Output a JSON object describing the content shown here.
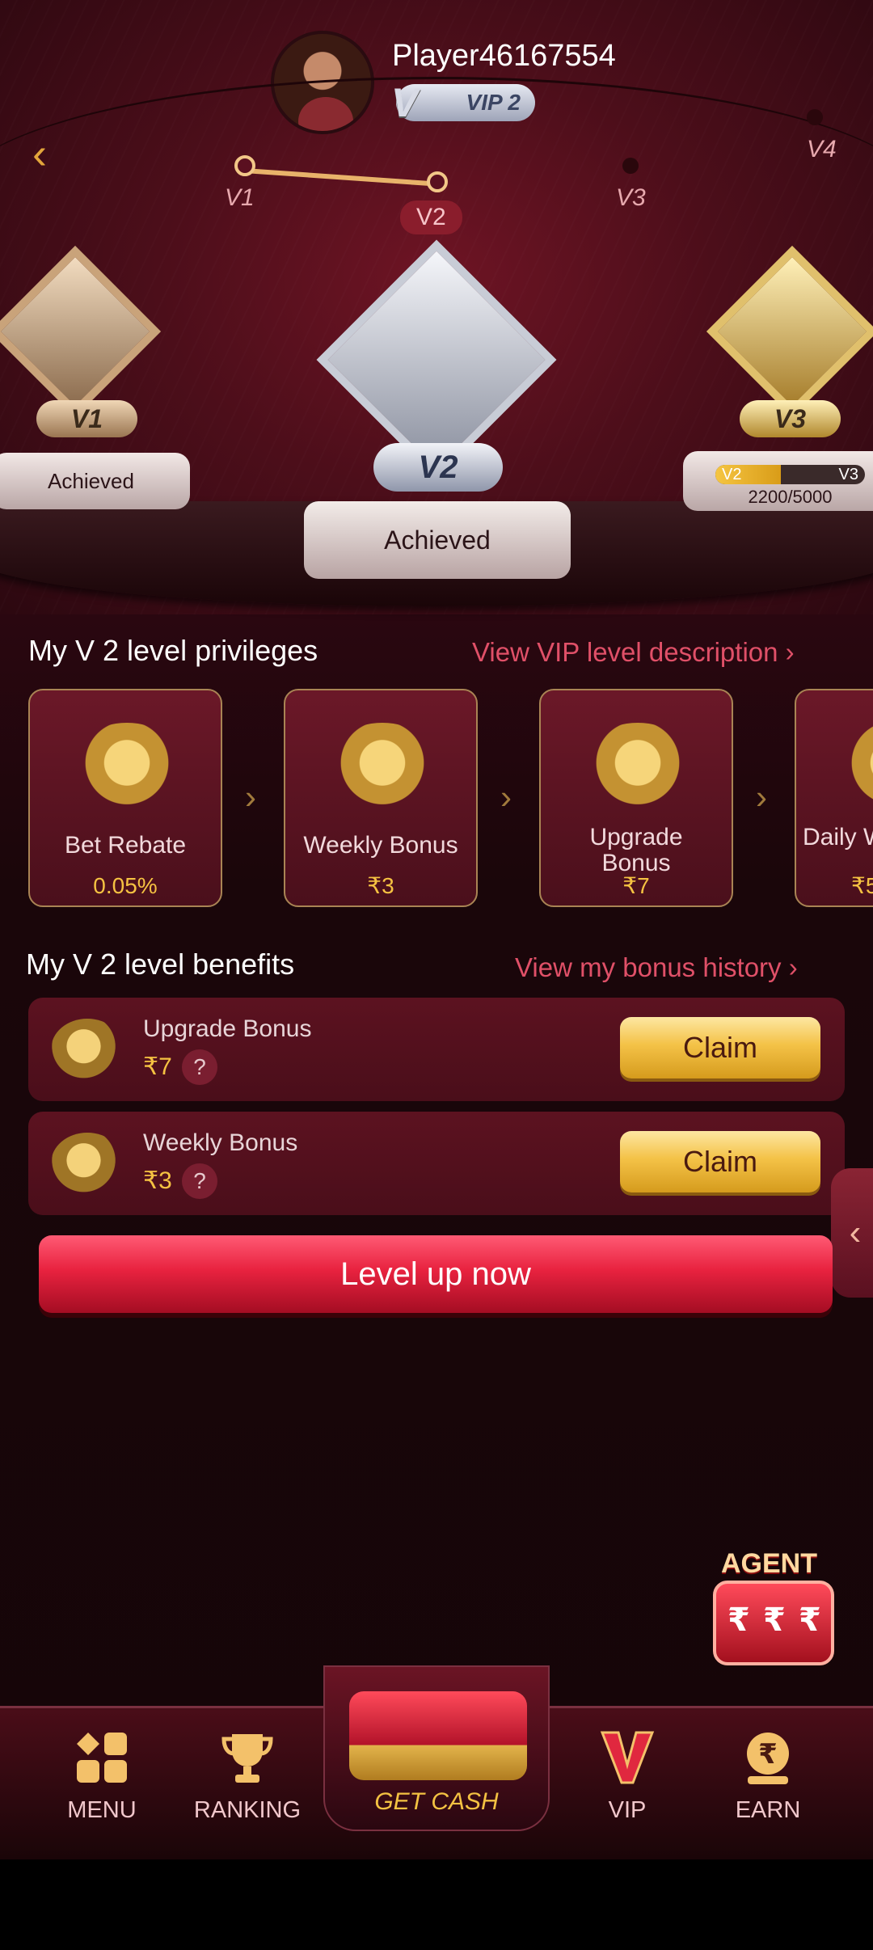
{
  "player": {
    "name": "Player46167554",
    "vip_label": "VIP 2",
    "vip_letter": "V"
  },
  "header": {
    "back_icon": "back-arrow-icon"
  },
  "track": {
    "levels": [
      "V1",
      "V2",
      "V3",
      "V4"
    ],
    "current": "V2"
  },
  "podiums": {
    "left": {
      "tag": "V1",
      "status": "Achieved"
    },
    "center": {
      "tag": "V2",
      "status": "Achieved"
    },
    "right": {
      "tag": "V3",
      "from": "V2",
      "to": "V3",
      "progress_text": "2200/5000",
      "progress_fraction": 0.44
    }
  },
  "privileges": {
    "title": "My V 2 level privileges",
    "link": "View VIP level description",
    "items": [
      {
        "name": "Bet Rebate",
        "value": "0.05%"
      },
      {
        "name": "Weekly Bonus",
        "value": "₹3"
      },
      {
        "name": "Upgrade Bonus",
        "value": "₹7"
      },
      {
        "name": "Daily W",
        "value": "₹5"
      }
    ]
  },
  "benefits": {
    "title": "My V 2 level benefits",
    "link": "View my bonus history",
    "items": [
      {
        "name": "Upgrade Bonus",
        "amount": "₹7",
        "help": "?",
        "button": "Claim"
      },
      {
        "name": "Weekly Bonus",
        "amount": "₹3",
        "help": "?",
        "button": "Claim"
      }
    ]
  },
  "level_up_label": "Level up now",
  "agent": {
    "label": "AGENT",
    "symbol": "₹"
  },
  "nav": {
    "items": [
      "MENU",
      "RANKING",
      "GET CASH",
      "VIP",
      "EARN"
    ]
  },
  "colors": {
    "accent": "#e8223f",
    "gold": "#f5c242",
    "link": "#e05068",
    "bg": "#4a0d18"
  }
}
